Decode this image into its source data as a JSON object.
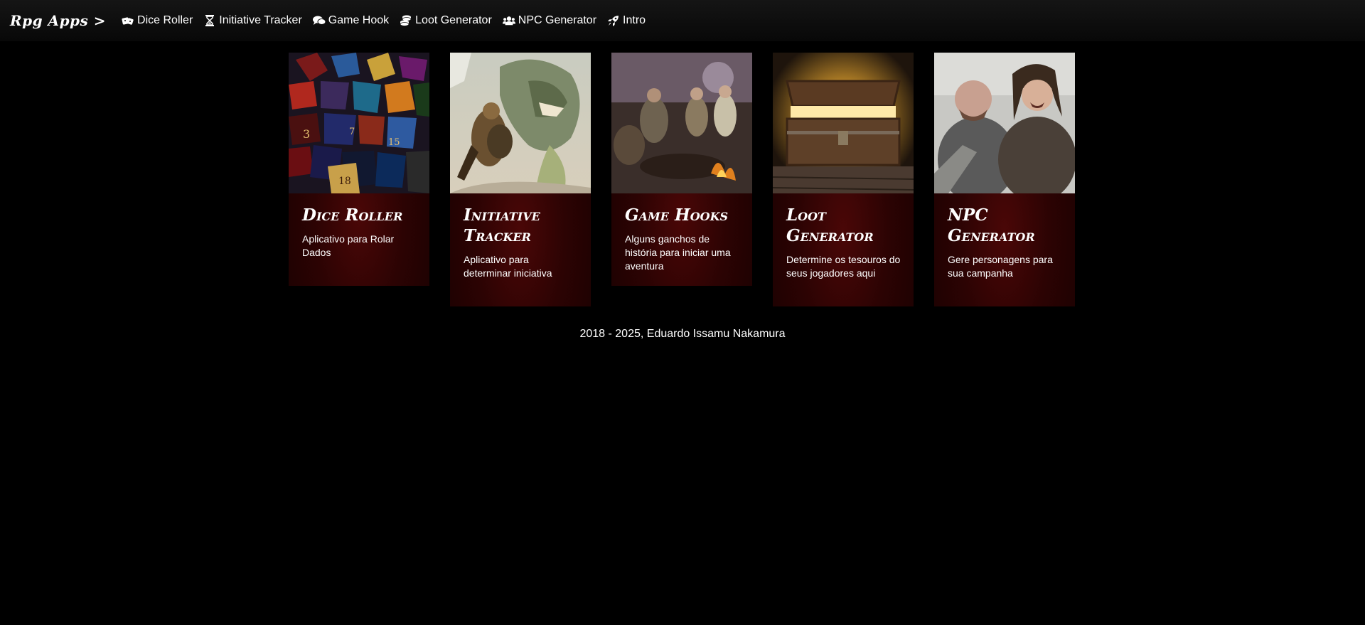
{
  "navbar": {
    "brand": "Rpg Apps >",
    "items": [
      {
        "label": "Dice Roller",
        "icon": "dice-icon"
      },
      {
        "label": "Initiative Tracker",
        "icon": "hourglass-icon"
      },
      {
        "label": "Game Hook",
        "icon": "comments-icon"
      },
      {
        "label": "Loot Generator",
        "icon": "coins-icon"
      },
      {
        "label": "NPC Generator",
        "icon": "users-icon"
      },
      {
        "label": "Intro",
        "icon": "rocket-icon"
      }
    ]
  },
  "cards": [
    {
      "title": "Dice Roller",
      "description": "Aplicativo para Rolar Dados",
      "image": "dice-pile-image"
    },
    {
      "title": "Initiative Tracker",
      "description": "Aplicativo para determinar iniciativa",
      "image": "warrior-vs-dragon-image"
    },
    {
      "title": "Game Hooks",
      "description": "Alguns ganchos de história para iniciar uma aventura",
      "image": "tavern-gathering-image"
    },
    {
      "title": "Loot Generator",
      "description": "Determine os tesouros do seus jogadores aqui",
      "image": "treasure-chest-image"
    },
    {
      "title": "NPC Generator",
      "description": "Gere personagens para sua campanha",
      "image": "vikings-image"
    }
  ],
  "footer": {
    "text": "2018 - 2025, Eduardo Issamu Nakamura"
  },
  "colors": {
    "background": "#000000",
    "navbar": "#111111",
    "card_accent": "#3a0505",
    "text": "#ffffff"
  }
}
